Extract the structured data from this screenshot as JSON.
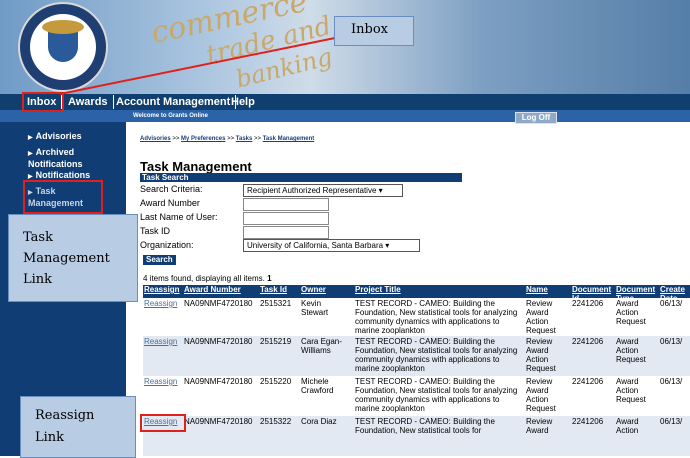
{
  "header": {
    "swirl_words": [
      "commerce",
      "trade and",
      "banking"
    ],
    "seal_top": "DEPARTMENT OF COMMERCE",
    "seal_bottom": "UNITED STATES OF AMERICA"
  },
  "nav": {
    "tabs": [
      "Inbox",
      "Awards",
      "Account Management",
      "Help"
    ]
  },
  "topbar": {
    "welcome": "Welcome to Grants Online",
    "logoff": "Log Off"
  },
  "sidebar": {
    "items": [
      "Advisories",
      "Archived Notifications",
      "Notifications",
      "Task Management"
    ]
  },
  "breadcrumb": {
    "items": [
      "Advisories",
      "My Preferences",
      "Tasks",
      "Task Management"
    ],
    "sep": ">>"
  },
  "page": {
    "title": "Task Management",
    "subheading": "Task Search"
  },
  "search": {
    "criteria_label": "Search Criteria:",
    "criteria_value": "Recipient Authorized Representative",
    "award_label": "Award Number",
    "lastname_label": "Last Name of User:",
    "taskid_label": "Task ID",
    "org_label": "Organization:",
    "org_value": "University of California, Santa Barbara",
    "button": "Search"
  },
  "results": {
    "summary": "4 items found, displaying all items.",
    "page_num": "1"
  },
  "table": {
    "headers": [
      "Reassign",
      "Award Number",
      "Task Id",
      "Owner",
      "Project Title",
      "Name",
      "Document Id",
      "Document Type",
      "Create Date"
    ],
    "rows": [
      {
        "reassign": "Reassign",
        "award": "NA09NMF4720180",
        "task": "2515321",
        "owner": "Kevin Stewart",
        "title": "TEST RECORD - CAMEO: Building the Foundation, New statistical tools for analyzing community dynamics with applications to marine zooplankton",
        "name": "Review Award Action Request",
        "doc_id": "2241206",
        "doc_type": "Award Action Request",
        "date": "06/13/"
      },
      {
        "reassign": "Reassign",
        "award": "NA09NMF4720180",
        "task": "2515219",
        "owner": "Cara Egan-Williams",
        "title": "TEST RECORD - CAMEO: Building the Foundation, New statistical tools for analyzing community dynamics with applications to marine zooplankton",
        "name": "Review Award Action Request",
        "doc_id": "2241206",
        "doc_type": "Award Action Request",
        "date": "06/13/"
      },
      {
        "reassign": "Reassign",
        "award": "NA09NMF4720180",
        "task": "2515220",
        "owner": "Michele Crawford",
        "title": "TEST RECORD - CAMEO: Building the Foundation, New statistical tools for analyzing community dynamics with applications to marine zooplankton",
        "name": "Review Award Action Request",
        "doc_id": "2241206",
        "doc_type": "Award Action Request",
        "date": "06/13/"
      },
      {
        "reassign": "Reassign",
        "award": "NA09NMF4720180",
        "task": "2515322",
        "owner": "Cora Diaz",
        "title": "TEST RECORD - CAMEO: Building the Foundation, New statistical tools for",
        "name": "Review Award",
        "doc_id": "2241206",
        "doc_type": "Award Action",
        "date": "06/13/"
      }
    ]
  },
  "callouts": {
    "inbox": "Inbox",
    "task_mgmt": "Task Management Link",
    "reassign": "Reassign Link"
  },
  "colors": {
    "navy": "#0f3d74",
    "callout_fill": "#b8cce4",
    "highlight_red": "#e0201b"
  }
}
